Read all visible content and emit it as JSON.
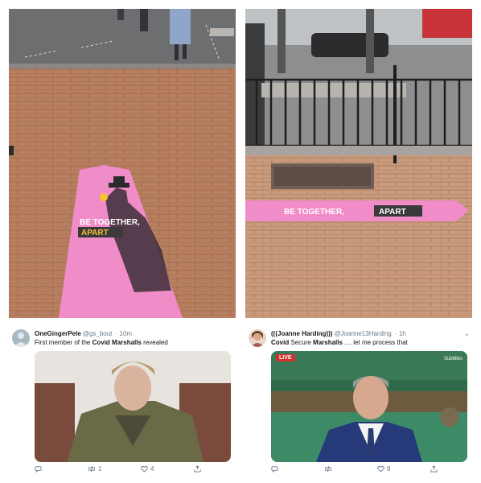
{
  "photo_left": {
    "sign_text_line1": "BE TOGETHER,",
    "sign_text_line2": "APART"
  },
  "photo_right": {
    "sign_text": "BE TOGETHER,",
    "sign_text_highlight": "APART"
  },
  "tweets": [
    {
      "name": "OneGingerPele",
      "handle": "@gs_bout",
      "time": "· 10m",
      "text_before": "First member of the ",
      "text_bold": "Covid Marshalls",
      "text_after": " revealed",
      "retweets": "1",
      "likes": "4"
    },
    {
      "name": "(((Joanne Harding)))",
      "handle": "@Joanne13Harding",
      "time": "· 1h",
      "text_bold1": "Covid",
      "text_mid": " Secure ",
      "text_bold2": "Marshalls",
      "text_after": " .... let me process that",
      "live_badge": "LIVE",
      "subtitles_label": "Subtitles",
      "retweets": "",
      "likes": "8"
    }
  ],
  "colors": {
    "sign_pink": "#f08cc8",
    "paving": "#b97f5c",
    "tweet_name": "#14171a",
    "tweet_meta": "#657786"
  }
}
